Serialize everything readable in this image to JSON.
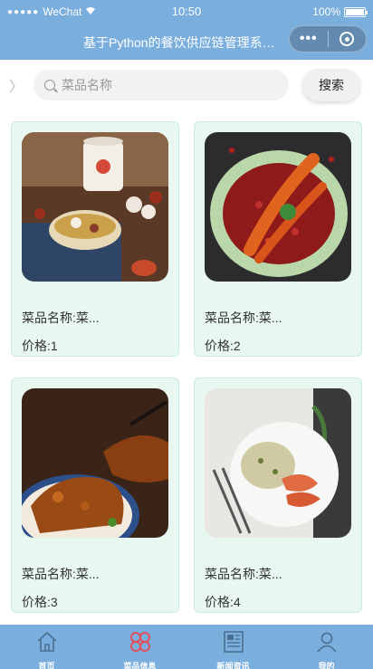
{
  "status_bar": {
    "carrier": "WeChat",
    "signal_dots": "●●●●●",
    "time": "10:50",
    "battery": "100%"
  },
  "nav_bar": {
    "title": "基于Python的餐饮供应链管理系统分...",
    "more": "•••"
  },
  "search": {
    "placeholder": "菜品名称",
    "button_label": "搜索"
  },
  "dishes": [
    {
      "name": "菜品名称:菜...",
      "price": "价格:1",
      "image": "soup-bowl-photo"
    },
    {
      "name": "菜品名称:菜...",
      "price": "价格:2",
      "image": "crayfish-chili-photo"
    },
    {
      "name": "菜品名称:菜...",
      "price": "价格:3",
      "image": "braised-pork-photo"
    },
    {
      "name": "菜品名称:菜...",
      "price": "价格:4",
      "image": "shrimp-rice-photo"
    }
  ],
  "tabs": [
    {
      "label": "首页",
      "icon": "home-icon",
      "active": false
    },
    {
      "label": "菜品信息",
      "icon": "clover-icon",
      "active": true
    },
    {
      "label": "新闻资讯",
      "icon": "newspaper-icon",
      "active": false
    },
    {
      "label": "我的",
      "icon": "person-icon",
      "active": false
    }
  ],
  "colors": {
    "nav_background": "#7aaedc",
    "card_background": "#e9f7f1",
    "card_border": "#c8ece0",
    "active_tab_icon": "#e04f5f",
    "inactive_tab_icon": "#4a6f8f"
  }
}
